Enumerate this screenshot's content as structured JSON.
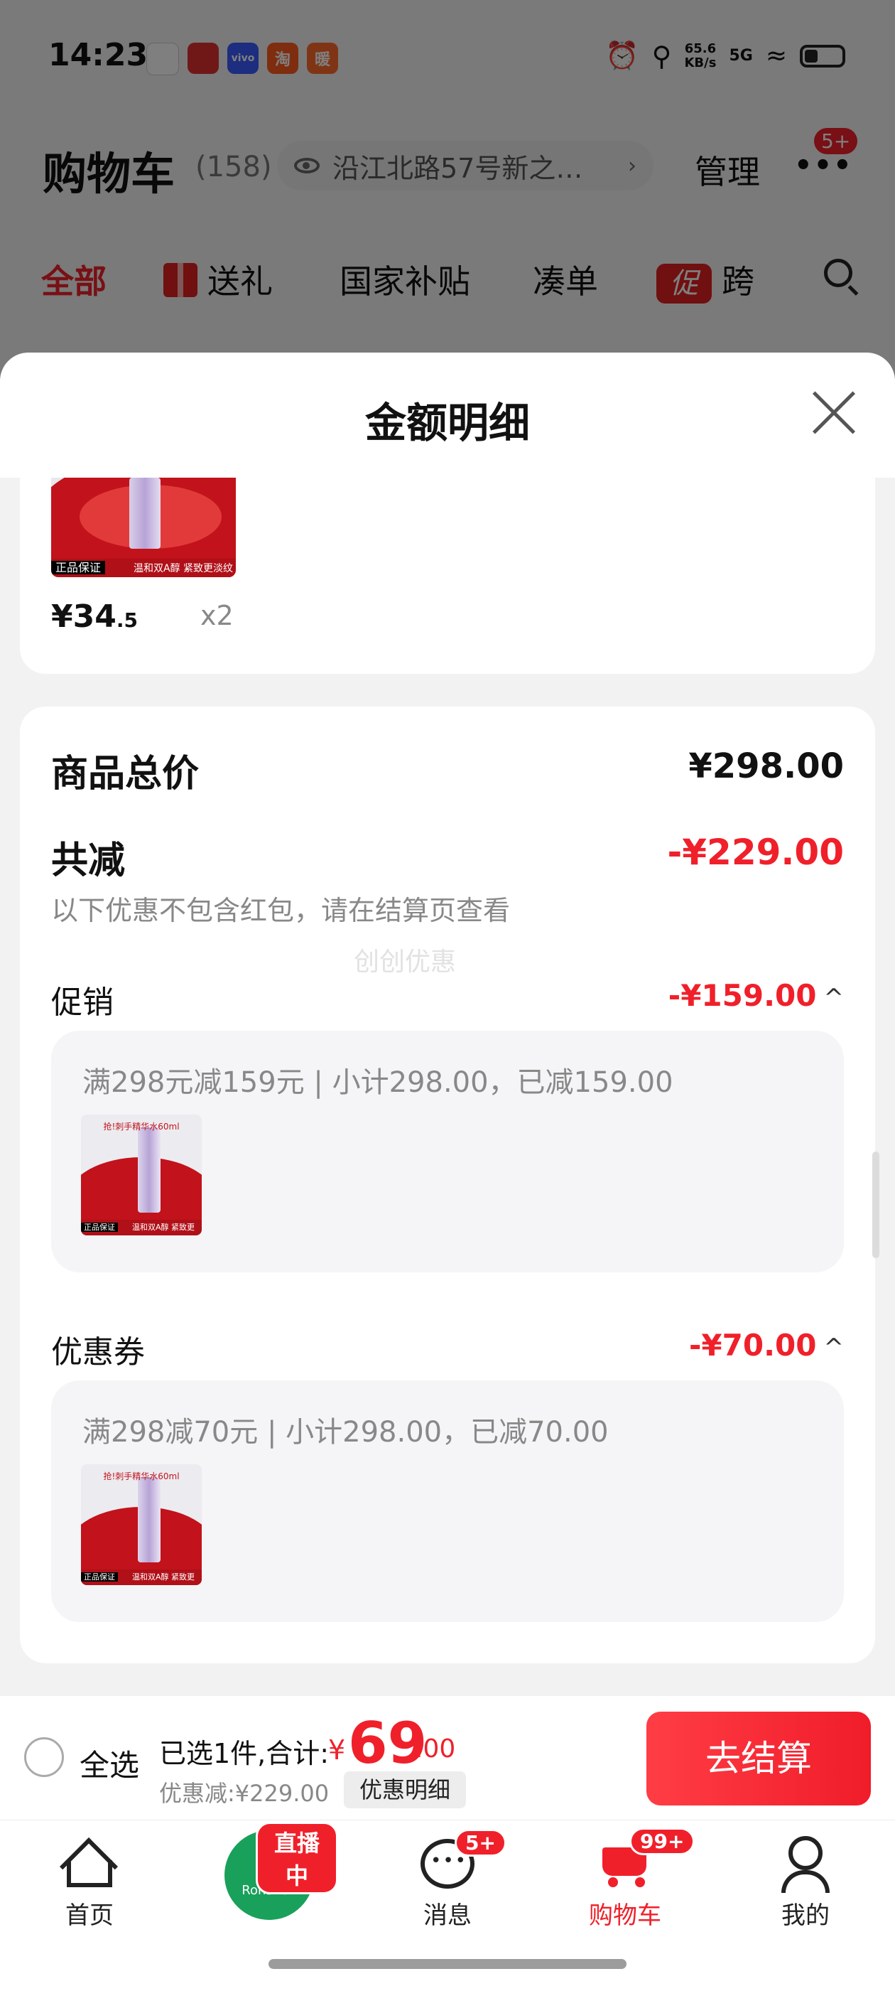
{
  "status_bar": {
    "time": "14:23",
    "net_speed_value": "65.6",
    "net_speed_unit": "KB/s",
    "network": "5G",
    "app_icons": [
      {
        "name": "white-app-icon",
        "label": "",
        "color": "#ffffff"
      },
      {
        "name": "lottery-app-icon",
        "label": "",
        "color": "#e03030"
      },
      {
        "name": "vivo-app-icon",
        "label": "vivo",
        "color": "#3a5bff"
      },
      {
        "name": "taobao-app-icon",
        "label": "淘",
        "color": "#ff5a1f"
      },
      {
        "name": "orange-app-icon",
        "label": "暖",
        "color": "#ff6a2a"
      }
    ]
  },
  "cart_header": {
    "title": "购物车",
    "count": "(158)",
    "address": "沿江北路57号新之…",
    "manage": "管理",
    "more_badge": "5+"
  },
  "category_tabs": {
    "all": "全部",
    "gift": "送礼",
    "subsidy": "国家补贴",
    "combine": "凑单",
    "promo_icon": "促",
    "cross": "跨"
  },
  "sheet": {
    "title": "金额明细",
    "product": {
      "price_int": "¥34",
      "price_dec": ".5",
      "qty": "x2",
      "image_tag": "正品保证",
      "image_text": "温和双A醇 紧致更淡纹"
    },
    "summary": {
      "total_label": "商品总价",
      "total_value": "¥298.00",
      "reduce_label": "共减",
      "reduce_value": "-¥229.00",
      "note": "以下优惠不包含红包，请在结算页查看",
      "watermark": "创创优惠"
    },
    "sections": [
      {
        "label": "促销",
        "value": "-¥159.00",
        "caret": "^",
        "detail": "满298元减159元 | 小计298.00，已减159.00",
        "thumb_title": "抢!刺手精华水60ml",
        "thumb_tag": "正品保证",
        "thumb_band": "温和双A醇 紧致更淡纹"
      },
      {
        "label": "优惠券",
        "value": "-¥70.00",
        "caret": "^",
        "detail": "满298减70元 | 小计298.00，已减70.00",
        "thumb_title": "抢!刺手精华水60ml",
        "thumb_tag": "正品保证",
        "thumb_band": "温和双A醇 紧致更淡纹"
      }
    ]
  },
  "checkout": {
    "select_all": "全选",
    "selected_text": "已选1件,合计:",
    "currency": "¥",
    "amount_int": "69",
    "amount_dec": ".00",
    "discount_text": "优惠减:¥229.00",
    "discount_detail_button": "优惠明细",
    "pay_button": "去结算"
  },
  "bottom_nav": {
    "items": [
      {
        "label": "首页"
      },
      {
        "label": "",
        "badge": "直播中",
        "avatar_text": "Ronshen"
      },
      {
        "label": "消息",
        "badge": "5+"
      },
      {
        "label": "购物车",
        "badge": "99+"
      },
      {
        "label": "我的"
      }
    ]
  },
  "colors": {
    "accent_red": "#f0202a",
    "text_dark": "#111111",
    "text_gray": "#888888",
    "live_green": "#19a05a"
  }
}
